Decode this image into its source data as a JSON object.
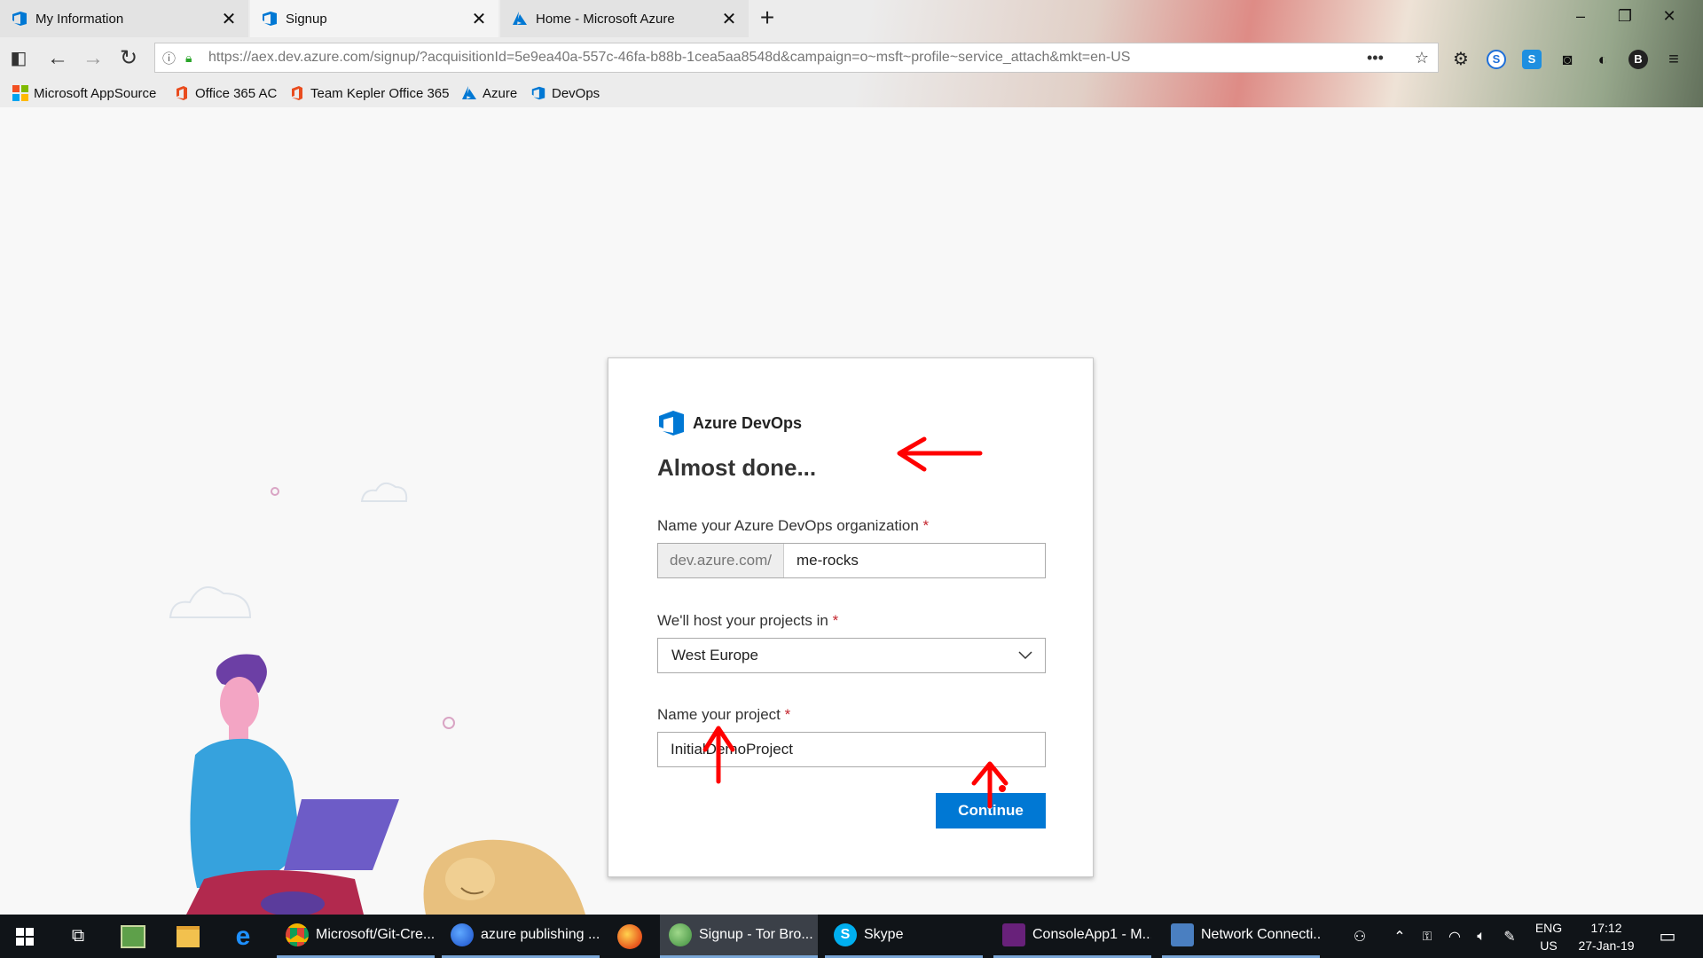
{
  "browser": {
    "tabs": [
      {
        "label": "My Information",
        "icon": "devops-icon",
        "active": false
      },
      {
        "label": "Signup",
        "icon": "devops-icon",
        "active": true
      },
      {
        "label": "Home - Microsoft Azure",
        "icon": "azure-icon",
        "active": false
      }
    ],
    "tab_close_glyph": "✕",
    "new_tab_glyph": "+",
    "url": "https://aex.dev.azure.com/signup/?acquisitionId=5e9ea40a-557c-46fa-b88b-1cea5aa8548d&campaign=o~msft~profile~service_attach&mkt=en-US",
    "bookmarks": [
      {
        "label": "Microsoft AppSource",
        "icon": "microsoft-logo-icon"
      },
      {
        "label": "Office 365 AC",
        "icon": "office-icon"
      },
      {
        "label": "Team Kepler Office 365",
        "icon": "office-icon"
      },
      {
        "label": "Azure",
        "icon": "azure-icon"
      },
      {
        "label": "DevOps",
        "icon": "devops-icon"
      }
    ],
    "colors": {
      "secure": "#2aa52a",
      "office": "#e94c1e",
      "azure": "#0078d4"
    }
  },
  "signup": {
    "brand": "Azure DevOps",
    "heading": "Almost done...",
    "org_label": "Name your Azure DevOps organization",
    "org_prefix": "dev.azure.com/",
    "org_value": "me-rocks",
    "region_label": "We'll host your projects in",
    "region_value": "West Europe",
    "project_label": "Name your project",
    "project_value": "InitialDemoProject",
    "required_marker": "*",
    "continue_label": "Continue",
    "colors": {
      "primary": "#0078d4",
      "required": "#c4262e",
      "annotation": "#ff0000"
    }
  },
  "taskbar": {
    "apps": [
      {
        "label": "Microsoft/Git-Cre...",
        "icon": "chrome-icon",
        "active": false
      },
      {
        "label": "azure publishing ...",
        "icon": "firefox-dev-icon",
        "active": false
      },
      {
        "label": "Signup - Tor Bro...",
        "icon": "tor-browser-icon",
        "active": true
      },
      {
        "label": "Skype",
        "icon": "skype-icon",
        "active": false
      },
      {
        "label": "ConsoleApp1 - M...",
        "icon": "visual-studio-icon",
        "active": false
      },
      {
        "label": "Network Connecti...",
        "icon": "network-connections-icon",
        "active": false
      }
    ],
    "lang_top": "ENG",
    "lang_bottom": "US",
    "time": "17:12",
    "date": "27-Jan-19"
  }
}
